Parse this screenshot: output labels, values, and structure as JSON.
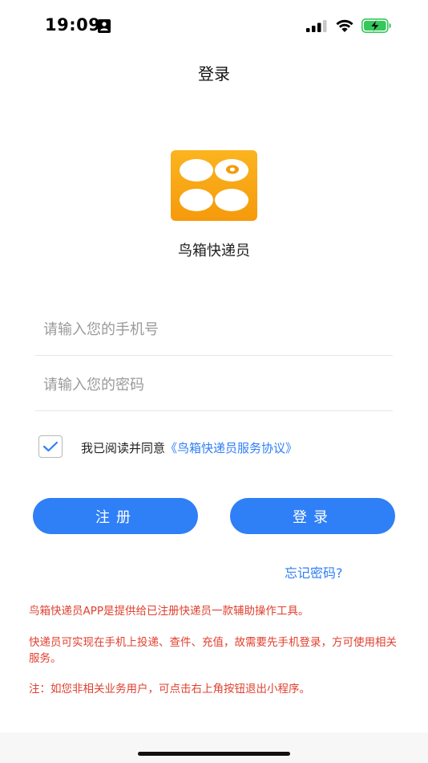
{
  "status_bar": {
    "time": "19:09",
    "icons": [
      "id-card-icon",
      "signal-icon",
      "wifi-icon",
      "battery-charging-icon"
    ],
    "battery_color": "#34c759"
  },
  "nav": {
    "title": "登录"
  },
  "app": {
    "name": "鸟箱快递员",
    "logo_icon": "app-logo-icon",
    "logo_color": "#f7a416"
  },
  "form": {
    "phone_placeholder": "请输入您的手机号",
    "phone_value": "",
    "password_placeholder": "请输入您的密码",
    "password_value": ""
  },
  "agreement": {
    "checked": true,
    "text": "我已阅读并同意",
    "link": "《鸟箱快递员服务协议》"
  },
  "buttons": {
    "register": "注册",
    "login": "登录"
  },
  "forgot_password": "忘记密码?",
  "notices": [
    "鸟箱快递员APP是提供给已注册快递员一款辅助操作工具。",
    "快递员可实现在手机上投递、查件、充值，故需要先手机登录，方可使用相关服务。",
    "注：如您非相关业务用户，可点击右上角按钮退出小程序。"
  ],
  "colors": {
    "accent": "#2f7ff6",
    "notice": "#e0402f"
  }
}
